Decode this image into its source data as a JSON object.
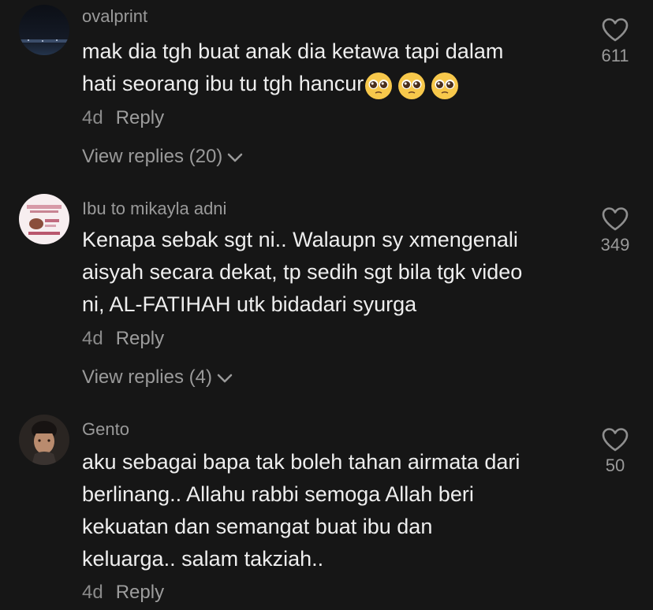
{
  "comments": [
    {
      "username": "ovalprint",
      "lines": [
        "mak dia tgh buat anak dia ketawa tapi dalam",
        "hati seorang ibu tu tgh hancur"
      ],
      "emojis": [
        "pleading-face",
        "pleading-face",
        "pleading-face"
      ],
      "time": "4d",
      "reply_label": "Reply",
      "view_replies": "View replies (20)",
      "likes": "611"
    },
    {
      "username": "Ibu to mikayla adni",
      "lines": [
        "Kenapa sebak sgt ni.. Walaupn sy xmengenali",
        "aisyah secara dekat, tp sedih sgt bila tgk video",
        "ni, AL-FATIHAH utk bidadari syurga"
      ],
      "time": "4d",
      "reply_label": "Reply",
      "view_replies": "View replies (4)",
      "likes": "349"
    },
    {
      "username": "Gento",
      "lines": [
        "aku sebagai bapa tak boleh tahan airmata dari",
        "berlinang.. Allahu rabbi semoga Allah beri",
        "kekuatan dan semangat buat ibu dan",
        "keluarga.. salam takziah.."
      ],
      "time": "4d",
      "reply_label": "Reply",
      "likes": "50"
    }
  ],
  "colors": {
    "background": "#161616",
    "text": "#eeeeee",
    "muted": "#9a9a9a"
  }
}
